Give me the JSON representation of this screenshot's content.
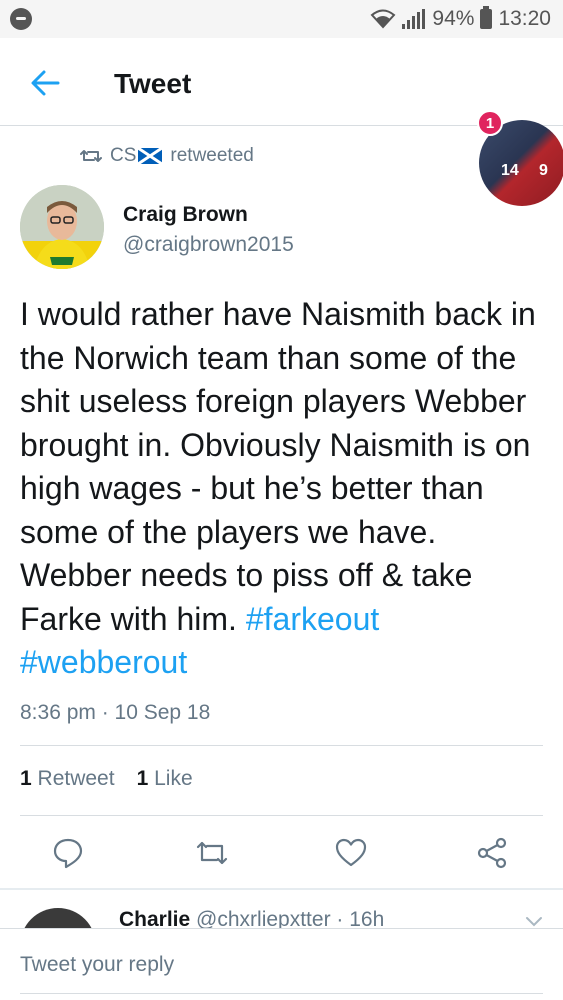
{
  "status_bar": {
    "battery": "94%",
    "time": "13:20"
  },
  "header": {
    "title": "Tweet"
  },
  "retweet": {
    "retweeter": "CS",
    "label": "retweeted"
  },
  "notification_avatar": {
    "badge_count": "1",
    "jersey_left": "14",
    "jersey_right": "9"
  },
  "tweet": {
    "author_name": "Craig Brown",
    "author_handle": "@craigbrown2015",
    "text": "I would rather have Naismith back in the Norwich team than some of the shit useless foreign players Webber brought in. Obviously Naismith is on high wages - but he’s better than some of the players we have. Webber needs to piss off & take Farke with him.",
    "hashtags": [
      "#farkeout",
      "#webberout"
    ],
    "timestamp": "8:36 pm · 10 Sep 18"
  },
  "stats": {
    "retweet_count": "1",
    "retweet_label": "Retweet",
    "like_count": "1",
    "like_label": "Like"
  },
  "reply_preview": {
    "name": "Charlie",
    "handle_time": "@chxrliepxtter · 16h"
  },
  "reply_box": {
    "placeholder": "Tweet your reply"
  },
  "colors": {
    "accent": "#1da1f2",
    "secondary_text": "#657786",
    "primary_text": "#14171a",
    "badge": "#e0245e"
  },
  "icons": [
    "messenger-icon",
    "wifi-icon",
    "signal-icon",
    "battery-icon",
    "back-arrow-icon",
    "retweet-small-icon",
    "scotland-flag-icon",
    "reply-icon",
    "retweet-icon",
    "like-icon",
    "share-icon",
    "chevron-down-icon"
  ]
}
